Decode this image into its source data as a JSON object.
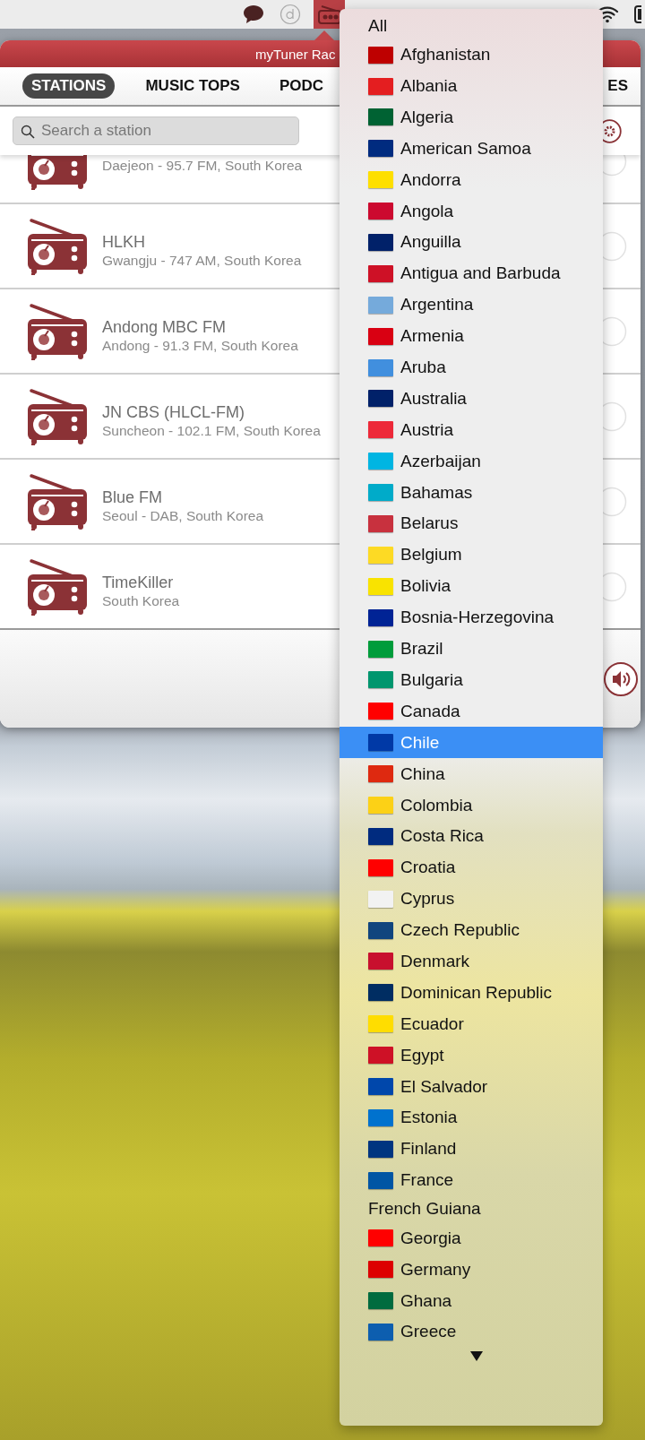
{
  "window": {
    "title": "myTuner Rac"
  },
  "tabs": [
    {
      "label": "STATIONS",
      "selected": true
    },
    {
      "label": "MUSIC TOPS",
      "selected": false
    },
    {
      "label": "PODC",
      "selected": false
    },
    {
      "label": "ES",
      "selected": false
    }
  ],
  "search": {
    "placeholder": "Search a station"
  },
  "stations": [
    {
      "location": "Daejeon - 95.7 FM, South Korea"
    },
    {
      "name": "HLKH",
      "location": "Gwangju - 747 AM, South Korea"
    },
    {
      "name": "Andong MBC FM",
      "location": "Andong - 91.3 FM, South Korea"
    },
    {
      "name": "JN CBS (HLCL-FM)",
      "location": "Suncheon - 102.1 FM, South Korea"
    },
    {
      "name": "Blue FM",
      "location": "Seoul - DAB, South Korea"
    },
    {
      "name": "TimeKiller",
      "location": "South Korea"
    }
  ],
  "country_menu": {
    "items": [
      {
        "label": "All",
        "selected": false
      },
      {
        "label": "Afghanistan",
        "color": "#be0000",
        "selected": false
      },
      {
        "label": "Albania",
        "color": "#e41e20",
        "selected": false
      },
      {
        "label": "Algeria",
        "color": "#006233",
        "selected": false
      },
      {
        "label": "American Samoa",
        "color": "#002b7f",
        "selected": false
      },
      {
        "label": "Andorra",
        "color": "#fedf00",
        "selected": false
      },
      {
        "label": "Angola",
        "color": "#cc092f",
        "selected": false
      },
      {
        "label": "Anguilla",
        "color": "#012169",
        "selected": false
      },
      {
        "label": "Antigua and Barbuda",
        "color": "#ce1126",
        "selected": false
      },
      {
        "label": "Argentina",
        "color": "#75aadb",
        "selected": false
      },
      {
        "label": "Armenia",
        "color": "#d90012",
        "selected": false
      },
      {
        "label": "Aruba",
        "color": "#418fde",
        "selected": false
      },
      {
        "label": "Australia",
        "color": "#012169",
        "selected": false
      },
      {
        "label": "Austria",
        "color": "#ed2939",
        "selected": false
      },
      {
        "label": "Azerbaijan",
        "color": "#00b5e2",
        "selected": false
      },
      {
        "label": "Bahamas",
        "color": "#00abc9",
        "selected": false
      },
      {
        "label": "Belarus",
        "color": "#c8313e",
        "selected": false
      },
      {
        "label": "Belgium",
        "color": "#fdda24",
        "selected": false
      },
      {
        "label": "Bolivia",
        "color": "#f9e300",
        "selected": false
      },
      {
        "label": "Bosnia-Herzegovina",
        "color": "#002395",
        "selected": false
      },
      {
        "label": "Brazil",
        "color": "#009c3b",
        "selected": false
      },
      {
        "label": "Bulgaria",
        "color": "#00966e",
        "selected": false
      },
      {
        "label": "Canada",
        "color": "#ff0000",
        "selected": false
      },
      {
        "label": "Chile",
        "color": "#0039a6",
        "selected": true
      },
      {
        "label": "China",
        "color": "#de2910",
        "selected": false
      },
      {
        "label": "Colombia",
        "color": "#fcd116",
        "selected": false
      },
      {
        "label": "Costa Rica",
        "color": "#002b7f",
        "selected": false
      },
      {
        "label": "Croatia",
        "color": "#ff0000",
        "selected": false
      },
      {
        "label": "Cyprus",
        "color": "#f2f2f2",
        "selected": false
      },
      {
        "label": "Czech Republic",
        "color": "#11457e",
        "selected": false
      },
      {
        "label": "Denmark",
        "color": "#c8102e",
        "selected": false
      },
      {
        "label": "Dominican Republic",
        "color": "#002d62",
        "selected": false
      },
      {
        "label": "Ecuador",
        "color": "#ffdd00",
        "selected": false
      },
      {
        "label": "Egypt",
        "color": "#ce1126",
        "selected": false
      },
      {
        "label": "El Salvador",
        "color": "#0047ab",
        "selected": false
      },
      {
        "label": "Estonia",
        "color": "#0072ce",
        "selected": false
      },
      {
        "label": "Finland",
        "color": "#003580",
        "selected": false
      },
      {
        "label": "France",
        "color": "#0055a4",
        "selected": false
      },
      {
        "label": "French Guiana",
        "selected": false
      },
      {
        "label": "Georgia",
        "color": "#ff0000",
        "selected": false
      },
      {
        "label": "Germany",
        "color": "#dd0000",
        "selected": false
      },
      {
        "label": "Ghana",
        "color": "#006b3f",
        "selected": false
      },
      {
        "label": "Greece",
        "color": "#0d5eaf",
        "selected": false
      }
    ]
  }
}
